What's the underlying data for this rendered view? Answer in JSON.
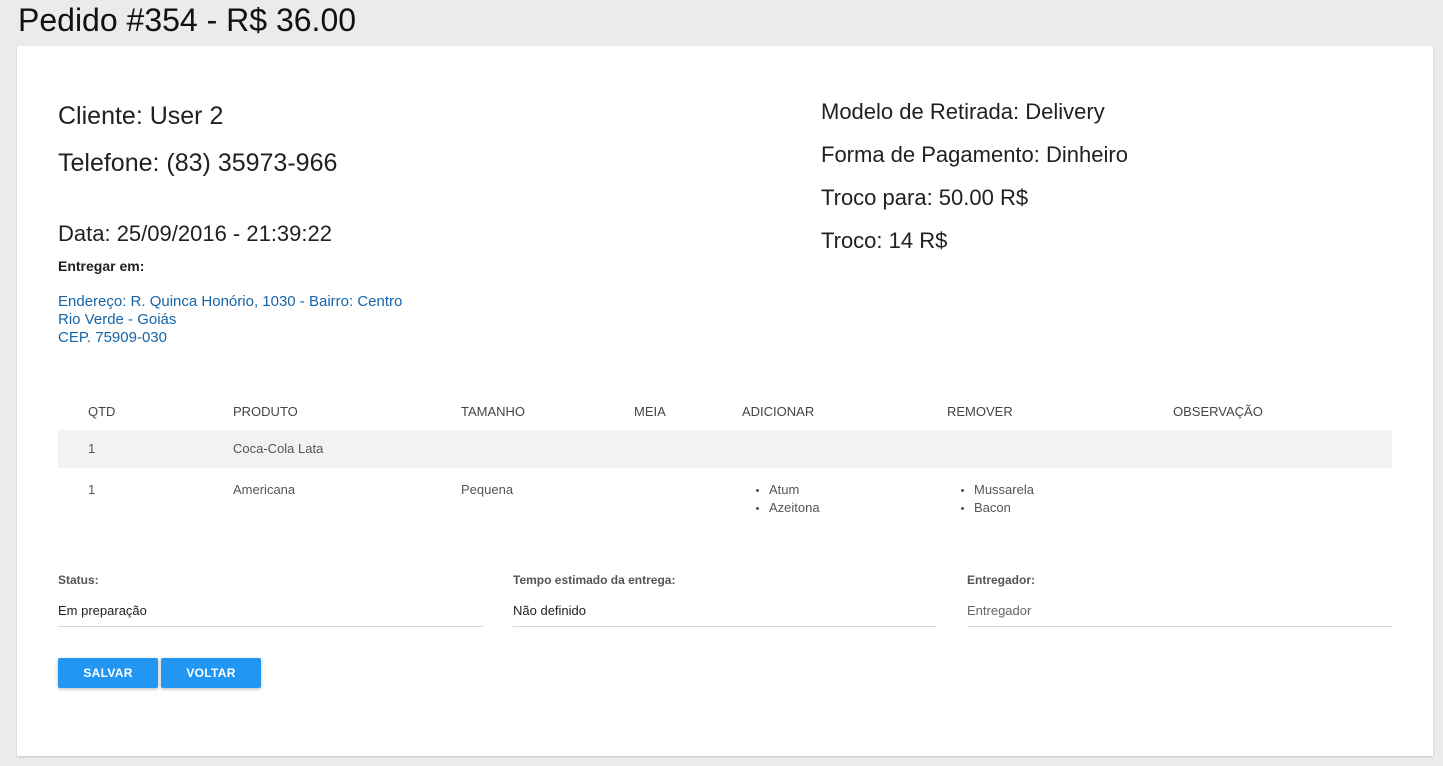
{
  "header": {
    "title": "Pedido #354 - R$ 36.00"
  },
  "client": {
    "name": "Cliente: User 2",
    "phone": "Telefone: (83) 35973-966",
    "date": "Data: 25/09/2016 - 21:39:22",
    "deliver_label": "Entregar em:",
    "address_lines": [
      "Endereço: R. Quinca Honório, 1030 - Bairro: Centro",
      "Rio Verde - Goiás",
      "CEP. 75909-030"
    ]
  },
  "delivery": {
    "mode": "Modelo de Retirada: Delivery",
    "payment": "Forma de Pagamento: Dinheiro",
    "change_for": "Troco para: 50.00 R$",
    "change": "Troco: 14 R$"
  },
  "table": {
    "headers": [
      "QTD",
      "PRODUTO",
      "TAMANHO",
      "MEIA",
      "ADICIONAR",
      "REMOVER",
      "OBSERVAÇÃO"
    ],
    "rows": [
      {
        "qtd": "1",
        "produto": "Coca-Cola Lata",
        "tamanho": "",
        "meia": "",
        "adicionar": [],
        "remover": [],
        "observacao": ""
      },
      {
        "qtd": "1",
        "produto": "Americana",
        "tamanho": "Pequena",
        "meia": "",
        "adicionar": [
          "Atum",
          "Azeitona"
        ],
        "remover": [
          "Mussarela",
          "Bacon"
        ],
        "observacao": ""
      }
    ]
  },
  "form": {
    "status_label": "Status:",
    "status_value": "Em preparação",
    "time_label": "Tempo estimado da entrega:",
    "time_value": "Não definido",
    "courier_label": "Entregador:",
    "courier_placeholder": "Entregador"
  },
  "buttons": {
    "save": "SALVAR",
    "back": "VOLTAR"
  },
  "colors": {
    "accent": "#2196f3",
    "address": "#1565a8",
    "background": "#ebebeb"
  }
}
